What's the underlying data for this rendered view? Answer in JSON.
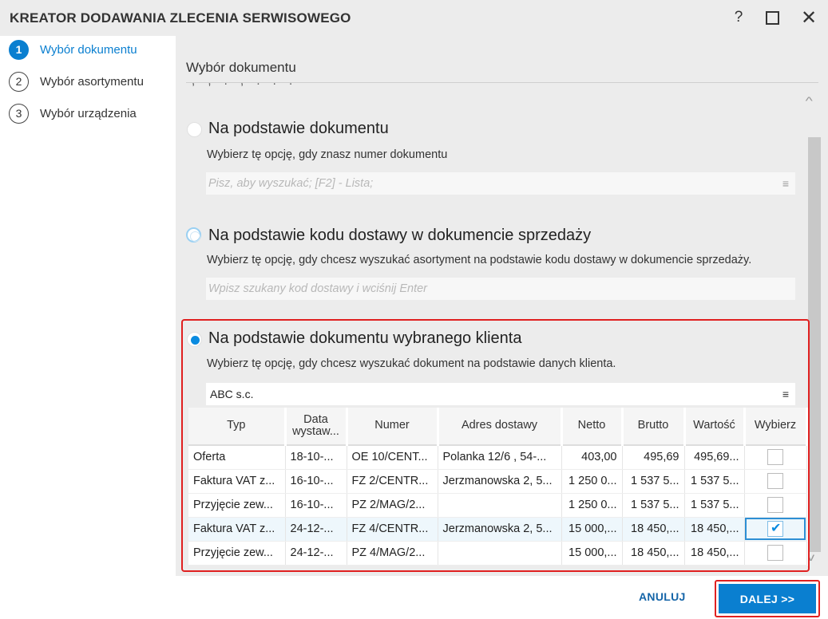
{
  "window": {
    "title": "KREATOR DODAWANIA ZLECENIA SERWISOWEGO",
    "help_glyph": "?",
    "close_glyph": "✕"
  },
  "steps": [
    {
      "num": "1",
      "label": "Wybór dokumentu"
    },
    {
      "num": "2",
      "label": "Wybór asortymentu"
    },
    {
      "num": "3",
      "label": "Wybór urządzenia"
    }
  ],
  "section": {
    "title": "Wybór dokumentu",
    "scroll_up": "^",
    "scroll_down": "v"
  },
  "options": {
    "by_document": {
      "title": "Na podstawie dokumentu",
      "desc": "Wybierz tę opcję, gdy znasz numer dokumentu",
      "placeholder": "Pisz, aby wyszukać; [F2] - Lista;"
    },
    "by_delivery_code": {
      "title": "Na podstawie kodu dostawy w dokumencie sprzedaży",
      "desc": "Wybierz tę opcję, gdy chcesz wyszukać asortyment na podstawie kodu dostawy w dokumencie sprzedaży.",
      "placeholder": "Wpisz szukany kod dostawy i wciśnij Enter"
    },
    "by_client": {
      "title": "Na podstawie dokumentu wybranego klienta",
      "desc": "Wybierz tę opcję, gdy chcesz wyszukać dokument na podstawie danych klienta.",
      "client_value": "ABC s.c."
    }
  },
  "list_icon_glyph": "≡",
  "table": {
    "headers": [
      "Typ",
      "Data wystaw...",
      "Numer",
      "Adres dostawy",
      "Netto",
      "Brutto",
      "Wartość",
      "Wybierz"
    ],
    "rows": [
      {
        "typ": "Oferta",
        "data": "18-10-...",
        "numer": "OE 10/CENT...",
        "adres": "Polanka  12/6 , 54-...",
        "netto": "403,00",
        "brutto": "495,69",
        "wartosc": "495,69...",
        "checked": false
      },
      {
        "typ": "Faktura VAT z...",
        "data": "16-10-...",
        "numer": "FZ 2/CENTR...",
        "adres": "Jerzmanowska 2, 5...",
        "netto": "1 250 0...",
        "brutto": "1 537 5...",
        "wartosc": "1 537 5...",
        "checked": false
      },
      {
        "typ": "Przyjęcie zew...",
        "data": "16-10-...",
        "numer": "PZ 2/MAG/2...",
        "adres": "",
        "netto": "1 250 0...",
        "brutto": "1 537 5...",
        "wartosc": "1 537 5...",
        "checked": false
      },
      {
        "typ": "Faktura VAT z...",
        "data": "24-12-...",
        "numer": "FZ 4/CENTR...",
        "adres": "Jerzmanowska 2, 5...",
        "netto": "15 000,...",
        "brutto": "18 450,...",
        "wartosc": "18 450,...",
        "checked": true
      },
      {
        "typ": "Przyjęcie zew...",
        "data": "24-12-...",
        "numer": "PZ 4/MAG/2...",
        "adres": "",
        "netto": "15 000,...",
        "brutto": "18 450,...",
        "wartosc": "18 450,...",
        "checked": false
      }
    ]
  },
  "buttons": {
    "cancel": "ANULUJ",
    "next": "DALEJ >>"
  }
}
